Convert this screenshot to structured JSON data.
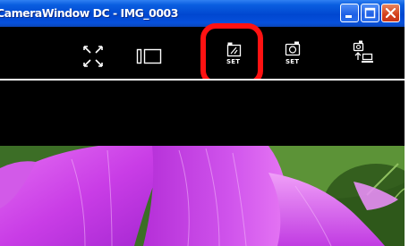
{
  "window": {
    "title": "CameraWindow DC - IMG_0003"
  },
  "title_controls": {
    "minimize_icon": "minimize-icon",
    "maximize_icon": "maximize-icon",
    "close_icon": "close-icon"
  },
  "toolbar": {
    "tools": [
      {
        "icon": "fullscreen-arrows-icon"
      },
      {
        "icon": "split-view-icon"
      },
      {
        "icon": "edit-image-set-icon",
        "label": "SET",
        "highlighted": true
      },
      {
        "icon": "camera-set-icon",
        "label": "SET"
      },
      {
        "icon": "transfer-to-computer-icon"
      }
    ]
  },
  "colors": {
    "highlight": "#ff1212",
    "titlebar": "#0047d0",
    "background": "#000000"
  },
  "photo": {
    "subject": "pink-flower-petals"
  }
}
